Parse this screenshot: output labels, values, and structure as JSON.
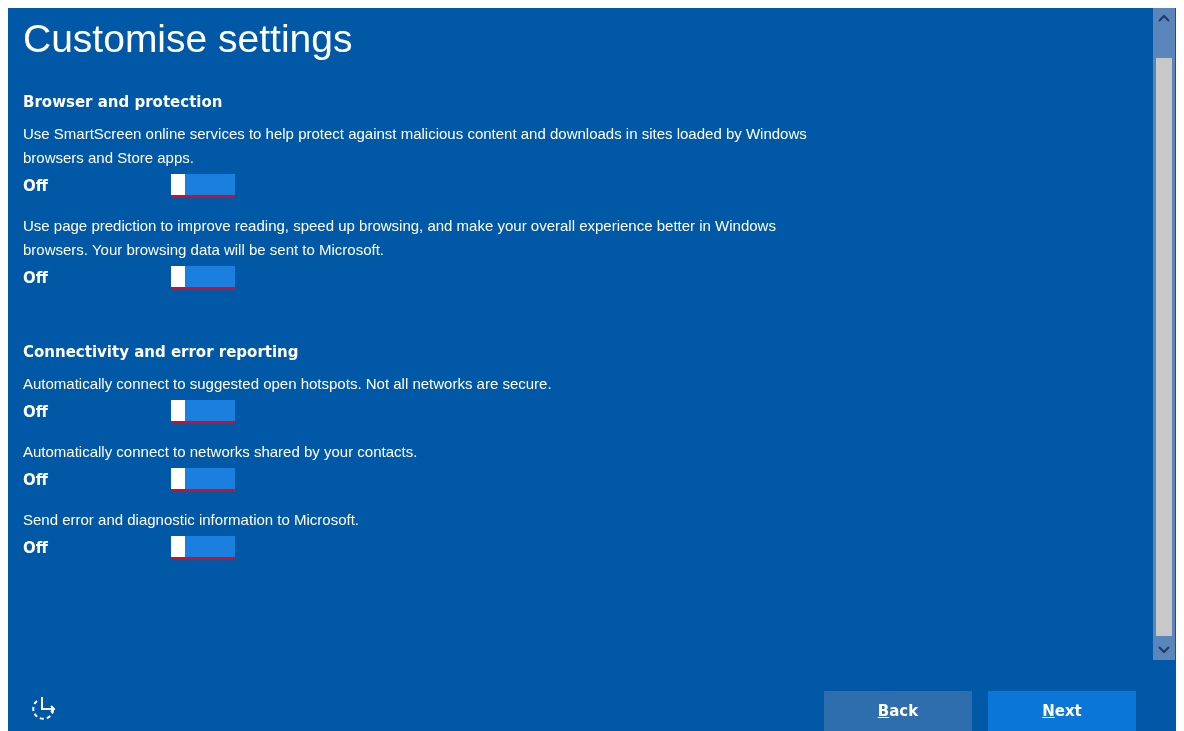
{
  "title": "Customise settings",
  "sections": [
    {
      "heading": "Browser and protection",
      "settings": [
        {
          "description": "Use SmartScreen online services to help protect against malicious content and downloads in sites loaded by Windows browsers and Store apps.",
          "state_label": "Off",
          "on": false
        },
        {
          "description": "Use page prediction to improve reading, speed up browsing, and make your overall experience better in Windows browsers. Your browsing data will be sent to Microsoft.",
          "state_label": "Off",
          "on": false
        }
      ]
    },
    {
      "heading": "Connectivity and error reporting",
      "settings": [
        {
          "description": "Automatically connect to suggested open hotspots. Not all networks are secure.",
          "state_label": "Off",
          "on": false
        },
        {
          "description": "Automatically connect to networks shared by your contacts.",
          "state_label": "Off",
          "on": false
        },
        {
          "description": "Send error and diagnostic information to Microsoft.",
          "state_label": "Off",
          "on": false
        }
      ]
    }
  ],
  "buttons": [
    {
      "label": "Back",
      "kind": "secondary"
    },
    {
      "label": "Next",
      "kind": "primary"
    }
  ]
}
